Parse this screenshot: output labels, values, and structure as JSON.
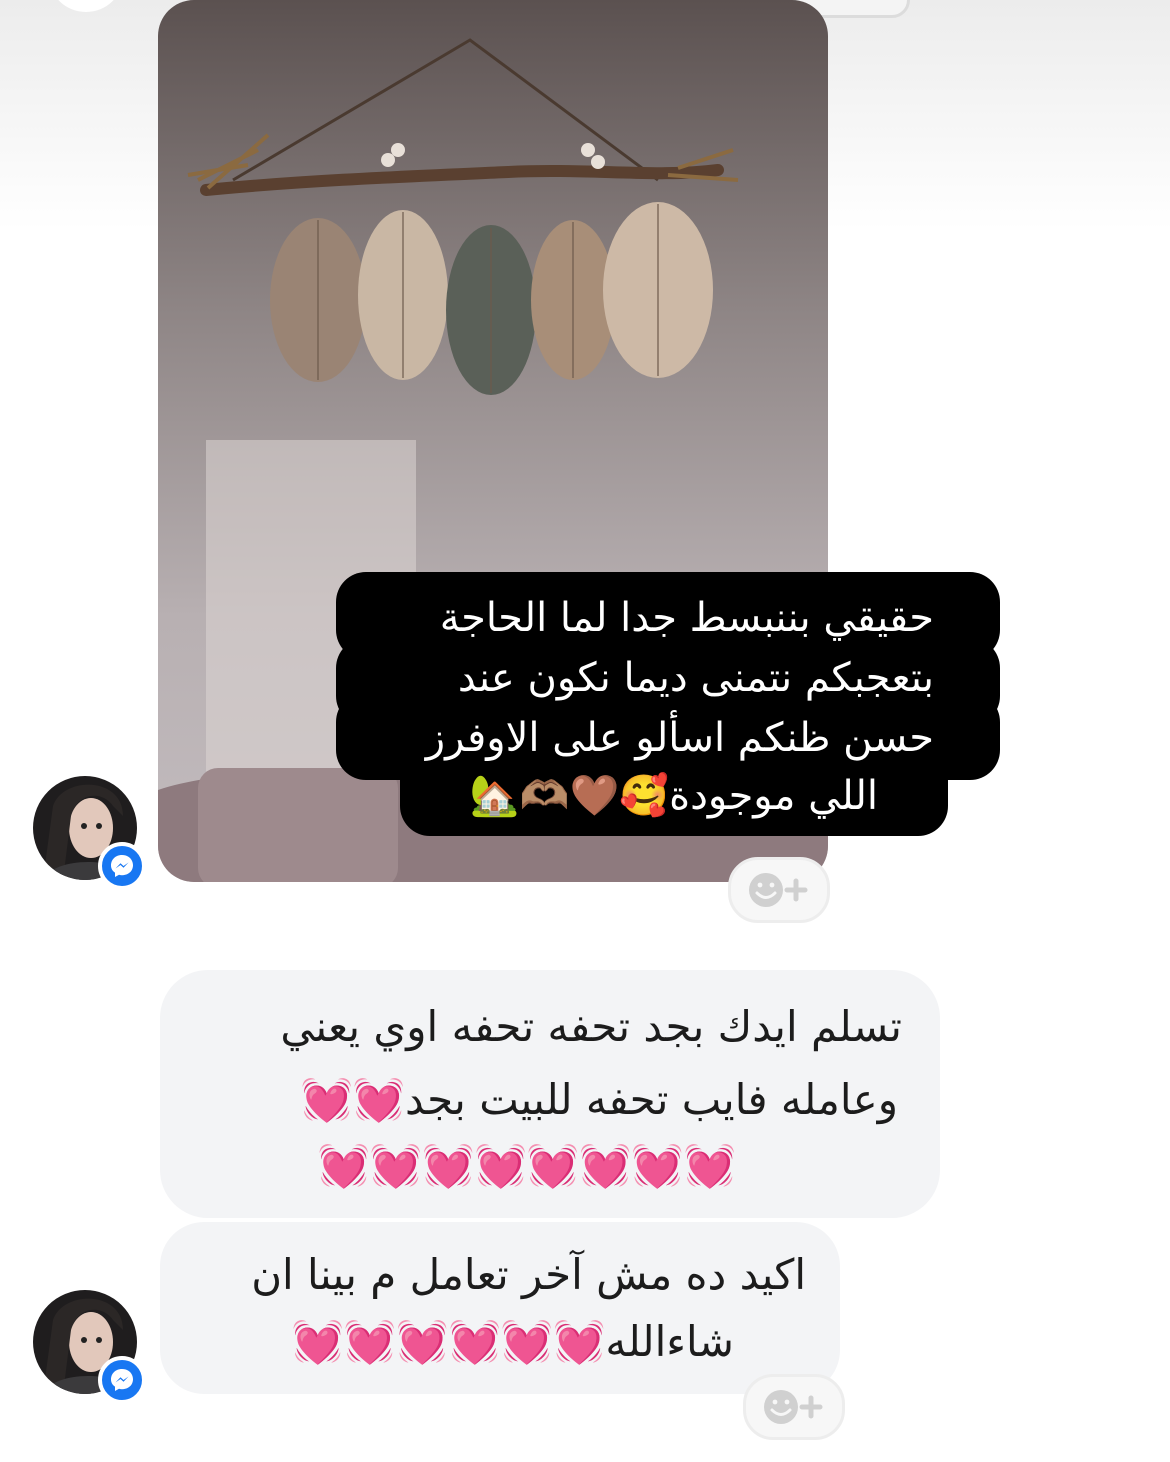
{
  "photo_message": {
    "caption_lines": [
      "حقيقي بننبسط جدا لما الحاجة",
      "بتعجبكم نتمنى ديما نكون عند",
      "حسن ظنكم اسألو على الاوفرز",
      "اللي موجودة🥰🤎🫶🏽🏡"
    ]
  },
  "reply_messages": [
    {
      "lines": [
        "تسلم ايدك بجد تحفه تحفه اوي يعني",
        "وعامله فايب تحفه للبيت بجد💓💓",
        "💓💓💓💓💓💓💓💓"
      ]
    },
    {
      "lines": [
        "اكيد ده مش آخر تعامل م بينا ان",
        "شاءالله💓💓💓💓💓💓"
      ]
    }
  ],
  "icons": {
    "reaction": "add-reaction-icon",
    "badge": "messenger-icon",
    "heart": "growing-heart-emoji"
  },
  "colors": {
    "caption_bg": "#000000",
    "bubble_bg": "#f3f4f6",
    "messenger_blue": "#1877f2",
    "heart_pink": "#ff3f9c"
  }
}
